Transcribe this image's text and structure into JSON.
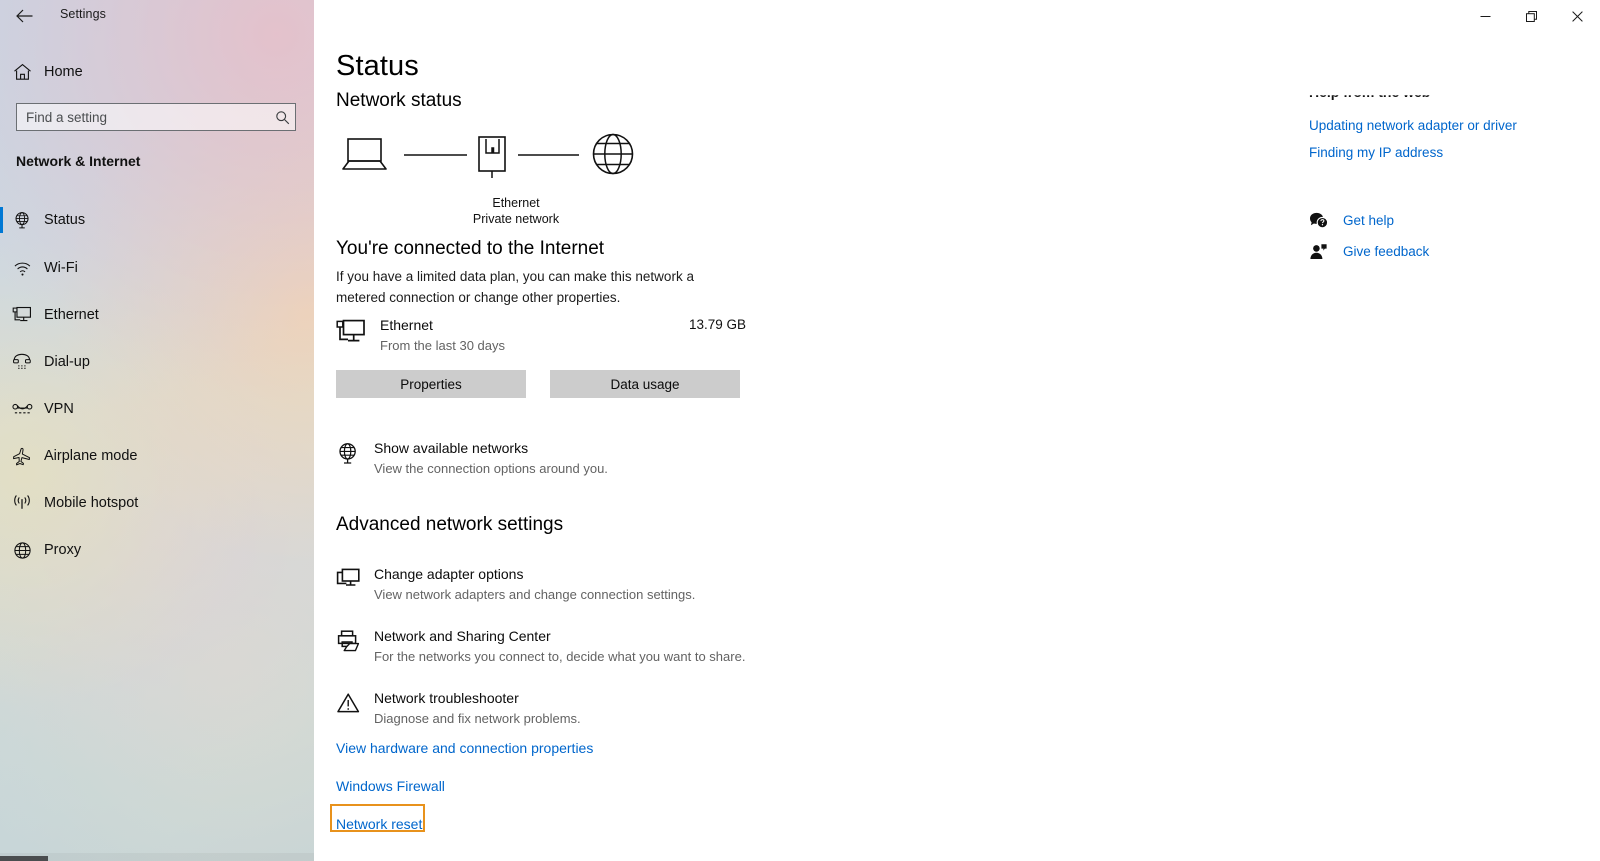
{
  "window": {
    "app_title": "Settings",
    "back_icon": "back-arrow-icon",
    "controls": {
      "minimize": "minimize-icon",
      "restore": "restore-icon",
      "close": "close-icon"
    }
  },
  "sidebar": {
    "home_label": "Home",
    "home_icon": "home-icon",
    "search": {
      "placeholder": "Find a setting",
      "value": "",
      "icon": "search-icon"
    },
    "group_title": "Network & Internet",
    "accent_color": "#0078d4",
    "items": [
      {
        "label": "Status",
        "icon": "network-status-icon",
        "selected": true
      },
      {
        "label": "Wi-Fi",
        "icon": "wifi-icon",
        "selected": false
      },
      {
        "label": "Ethernet",
        "icon": "ethernet-icon",
        "selected": false
      },
      {
        "label": "Dial-up",
        "icon": "dial-up-icon",
        "selected": false
      },
      {
        "label": "VPN",
        "icon": "vpn-icon",
        "selected": false
      },
      {
        "label": "Airplane mode",
        "icon": "airplane-icon",
        "selected": false
      },
      {
        "label": "Mobile hotspot",
        "icon": "hotspot-icon",
        "selected": false
      },
      {
        "label": "Proxy",
        "icon": "proxy-globe-icon",
        "selected": false
      }
    ]
  },
  "main": {
    "page_title": "Status",
    "section_network_status": "Network status",
    "diagram": {
      "device_icon": "laptop-icon",
      "adapter_icon": "ethernet-port-icon",
      "internet_icon": "globe-icon",
      "label_primary": "Ethernet",
      "label_secondary": "Private network"
    },
    "connected_heading": "You're connected to the Internet",
    "connected_description": "If you have a limited data plan, you can make this network a metered connection or change other properties.",
    "adapter": {
      "icon": "monitor-network-icon",
      "name": "Ethernet",
      "subtitle": "From the last 30 days",
      "usage": "13.79 GB"
    },
    "buttons": {
      "properties": "Properties",
      "data_usage": "Data usage"
    },
    "show_networks": {
      "icon": "globe-network-icon",
      "title": "Show available networks",
      "subtitle": "View the connection options around you."
    },
    "section_advanced": "Advanced network settings",
    "advanced_rows": [
      {
        "icon": "adapter-options-icon",
        "title": "Change adapter options",
        "subtitle": "View network adapters and change connection settings."
      },
      {
        "icon": "sharing-center-icon",
        "title": "Network and Sharing Center",
        "subtitle": "For the networks you connect to, decide what you want to share."
      },
      {
        "icon": "warning-triangle-icon",
        "title": "Network troubleshooter",
        "subtitle": "Diagnose and fix network problems."
      }
    ],
    "links": [
      "View hardware and connection properties",
      "Windows Firewall",
      "Network reset"
    ],
    "highlight": {
      "target": "Network reset",
      "color": "#e8921c"
    }
  },
  "right_rail": {
    "help_heading": "Help from the web",
    "links": [
      "Updating network adapter or driver",
      "Finding my IP address"
    ],
    "actions": [
      {
        "label": "Get help",
        "icon": "get-help-icon"
      },
      {
        "label": "Give feedback",
        "icon": "give-feedback-icon"
      }
    ]
  },
  "colors": {
    "link": "#0066cc",
    "accent": "#0078d4",
    "button_bg": "#cccccc",
    "highlight": "#e8921c"
  }
}
